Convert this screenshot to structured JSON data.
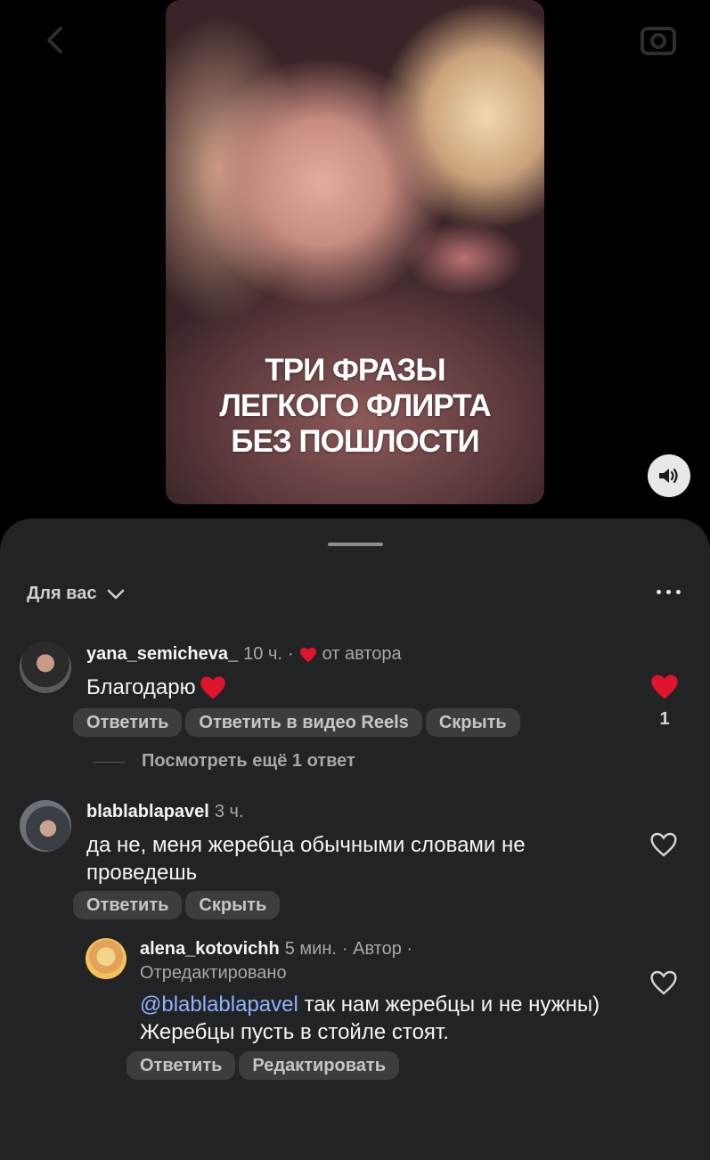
{
  "video": {
    "caption_lines": [
      "ТРИ ФРАЗЫ",
      "ЛЕГКОГО ФЛИРТА",
      "БЕЗ ПОШЛОСТИ"
    ],
    "sound_icon": "speaker-icon"
  },
  "sheet": {
    "filter_label": "Для вас",
    "more_icon": "more-dots-icon"
  },
  "comments": [
    {
      "username": "yana_semicheva_",
      "time": "10 ч.",
      "sep": "·",
      "author_like": "от автора",
      "text": "Благодарю",
      "actions": [
        "Ответить",
        "Ответить в видео Reels",
        "Скрыть"
      ],
      "like_count": "1",
      "liked": true,
      "view_replies": "Посмотреть ещё 1 ответ"
    },
    {
      "username": "blablablapavel",
      "time": "3 ч.",
      "text": "да не, меня жеребца обычными словами не проведешь",
      "actions": [
        "Ответить",
        "Скрыть"
      ],
      "liked": false
    }
  ],
  "reply": {
    "username": "alena_kotovichh",
    "time": "5 мин.",
    "author_tag": "· Автор ·",
    "edited": "Отредактировано",
    "mention": "@blablablapavel",
    "text": " так нам жеребцы и не нужны) Жеребцы пусть в стойле стоят.",
    "actions": [
      "Ответить",
      "Редактировать"
    ],
    "liked": false
  },
  "colors": {
    "sheet_bg": "#222325",
    "like_red": "#e0142c",
    "mention_blue": "#8fb4ff",
    "pill_bg": "#3b3d40"
  }
}
